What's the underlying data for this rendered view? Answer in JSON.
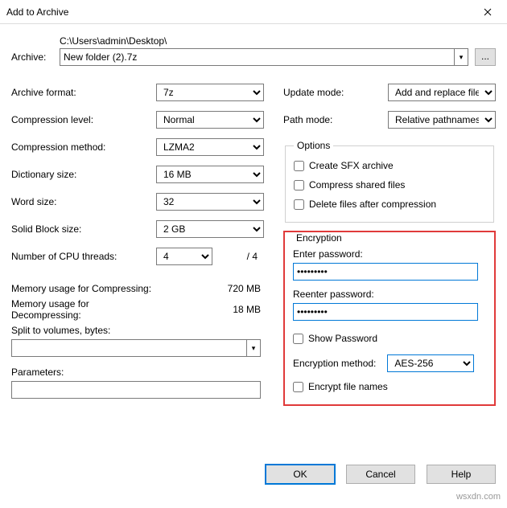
{
  "window": {
    "title": "Add to Archive"
  },
  "archive": {
    "label": "Archive:",
    "path": "C:\\Users\\admin\\Desktop\\",
    "filename": "New folder (2).7z",
    "browse": "..."
  },
  "left": {
    "format_label": "Archive format:",
    "format_value": "7z",
    "level_label": "Compression level:",
    "level_value": "Normal",
    "method_label": "Compression method:",
    "method_value": "LZMA2",
    "dict_label": "Dictionary size:",
    "dict_value": "16 MB",
    "word_label": "Word size:",
    "word_value": "32",
    "block_label": "Solid Block size:",
    "block_value": "2 GB",
    "cpu_label": "Number of CPU threads:",
    "cpu_value": "4",
    "cpu_max": "/ 4",
    "mem_comp_label": "Memory usage for Compressing:",
    "mem_comp_value": "720 MB",
    "mem_decomp_label": "Memory usage for Decompressing:",
    "mem_decomp_value": "18 MB",
    "split_label": "Split to volumes, bytes:",
    "split_value": "",
    "param_label": "Parameters:",
    "param_value": ""
  },
  "right": {
    "update_label": "Update mode:",
    "update_value": "Add and replace files",
    "pathmode_label": "Path mode:",
    "pathmode_value": "Relative pathnames",
    "options_legend": "Options",
    "opt_sfx": "Create SFX archive",
    "opt_shared": "Compress shared files",
    "opt_delete": "Delete files after compression",
    "enc_legend": "Encryption",
    "enter_pw": "Enter password:",
    "pw_value": "•••••••••",
    "reenter_pw": "Reenter password:",
    "pw2_value": "•••••••••",
    "show_pw": "Show Password",
    "enc_method_label": "Encryption method:",
    "enc_method_value": "AES-256",
    "enc_names": "Encrypt file names"
  },
  "buttons": {
    "ok": "OK",
    "cancel": "Cancel",
    "help": "Help"
  },
  "watermark": "wsxdn.com"
}
